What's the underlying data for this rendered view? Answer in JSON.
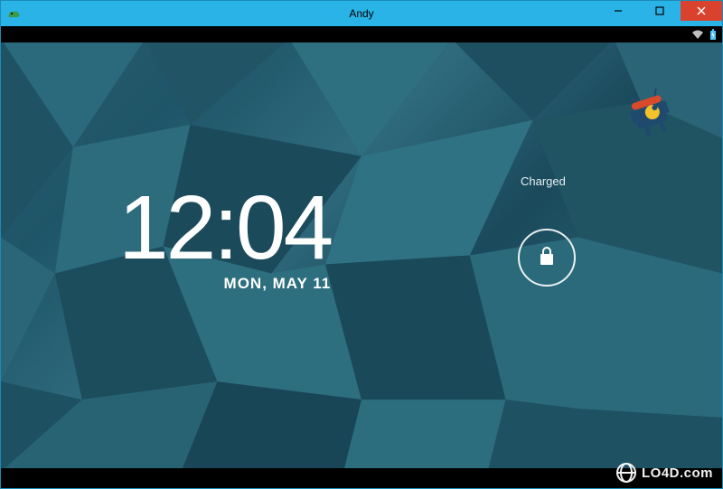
{
  "window": {
    "title": "Andy"
  },
  "lockscreen": {
    "time": "12:04",
    "date": "MON, MAY 11",
    "charge_status": "Charged"
  },
  "watermark": {
    "text": "LO4D.com"
  }
}
